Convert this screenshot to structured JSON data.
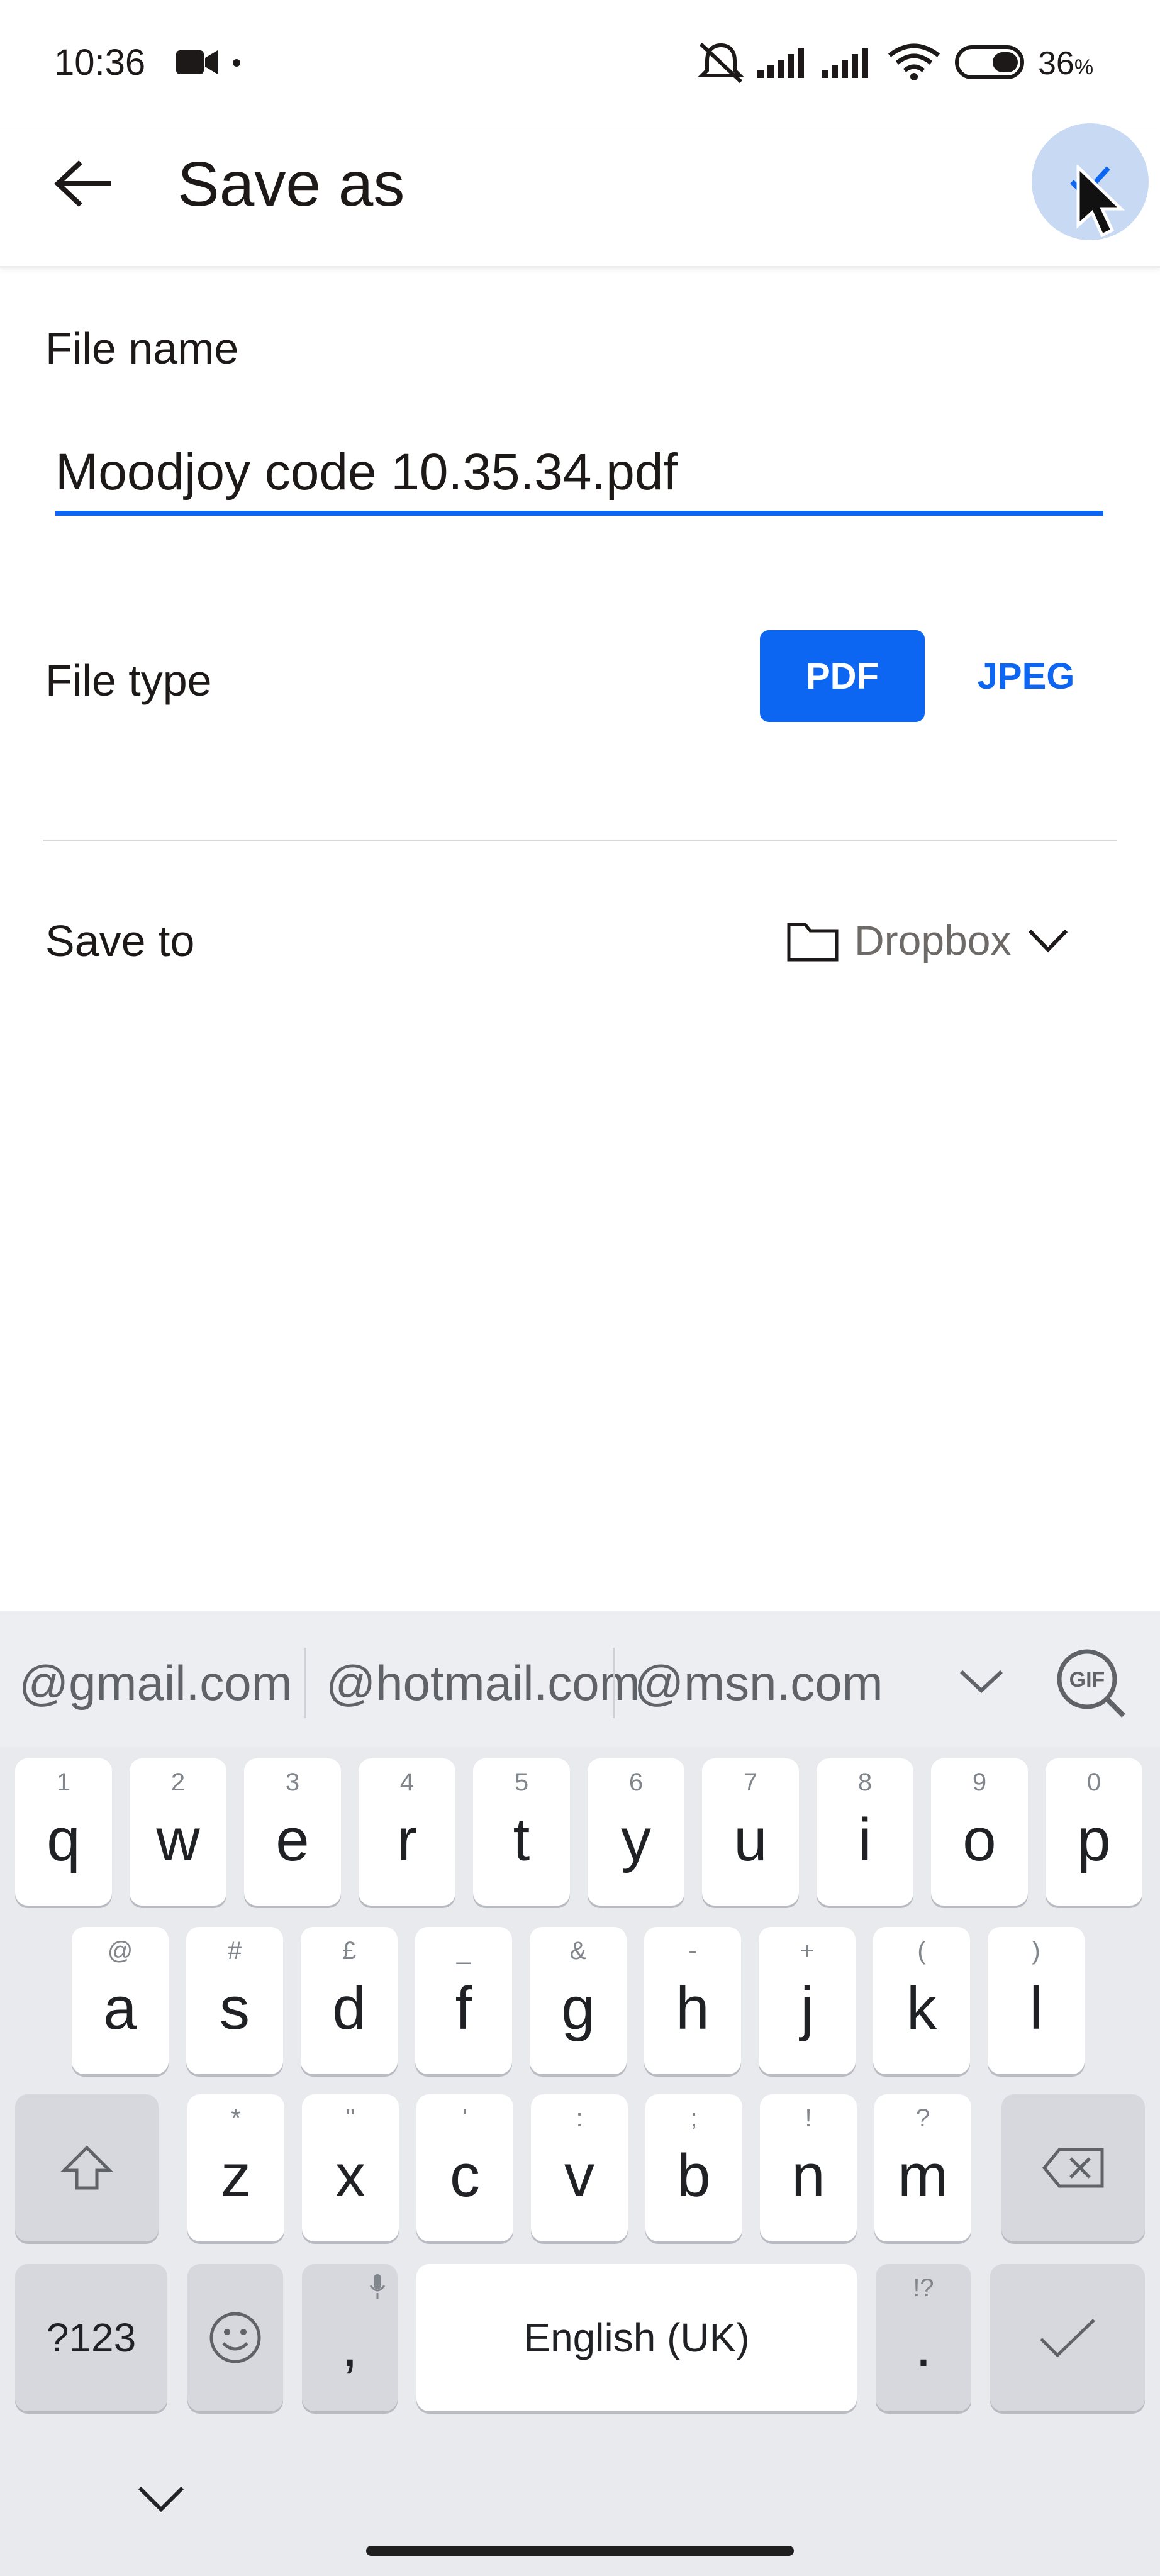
{
  "status_bar": {
    "time": "10:36",
    "battery": "36",
    "battery_unit": "%"
  },
  "app_bar": {
    "title": "Save as"
  },
  "form": {
    "file_name_label": "File name",
    "file_name_value": "Moodjoy code 10.35.34.pdf",
    "file_type_label": "File type",
    "file_types": [
      "PDF",
      "JPEG"
    ],
    "selected_type": "PDF",
    "save_to_label": "Save to",
    "save_to_value": "Dropbox"
  },
  "keyboard": {
    "suggestions": [
      "@gmail.com",
      "@hotmail.com",
      "@msn.com"
    ],
    "row1": [
      {
        "k": "q",
        "h": "1"
      },
      {
        "k": "w",
        "h": "2"
      },
      {
        "k": "e",
        "h": "3"
      },
      {
        "k": "r",
        "h": "4"
      },
      {
        "k": "t",
        "h": "5"
      },
      {
        "k": "y",
        "h": "6"
      },
      {
        "k": "u",
        "h": "7"
      },
      {
        "k": "i",
        "h": "8"
      },
      {
        "k": "o",
        "h": "9"
      },
      {
        "k": "p",
        "h": "0"
      }
    ],
    "row2": [
      {
        "k": "a",
        "h": "@"
      },
      {
        "k": "s",
        "h": "#"
      },
      {
        "k": "d",
        "h": "£"
      },
      {
        "k": "f",
        "h": "_"
      },
      {
        "k": "g",
        "h": "&"
      },
      {
        "k": "h",
        "h": "-"
      },
      {
        "k": "j",
        "h": "+"
      },
      {
        "k": "k",
        "h": "("
      },
      {
        "k": "l",
        "h": ")"
      }
    ],
    "row3": [
      {
        "k": "z",
        "h": "*"
      },
      {
        "k": "x",
        "h": "\""
      },
      {
        "k": "c",
        "h": "'"
      },
      {
        "k": "v",
        "h": ":"
      },
      {
        "k": "b",
        "h": ";"
      },
      {
        "k": "n",
        "h": "!"
      },
      {
        "k": "m",
        "h": "?"
      }
    ],
    "num_key": "?123",
    "comma": ",",
    "space_label": "English (UK)",
    "period": ".",
    "period_hint": "!?"
  }
}
